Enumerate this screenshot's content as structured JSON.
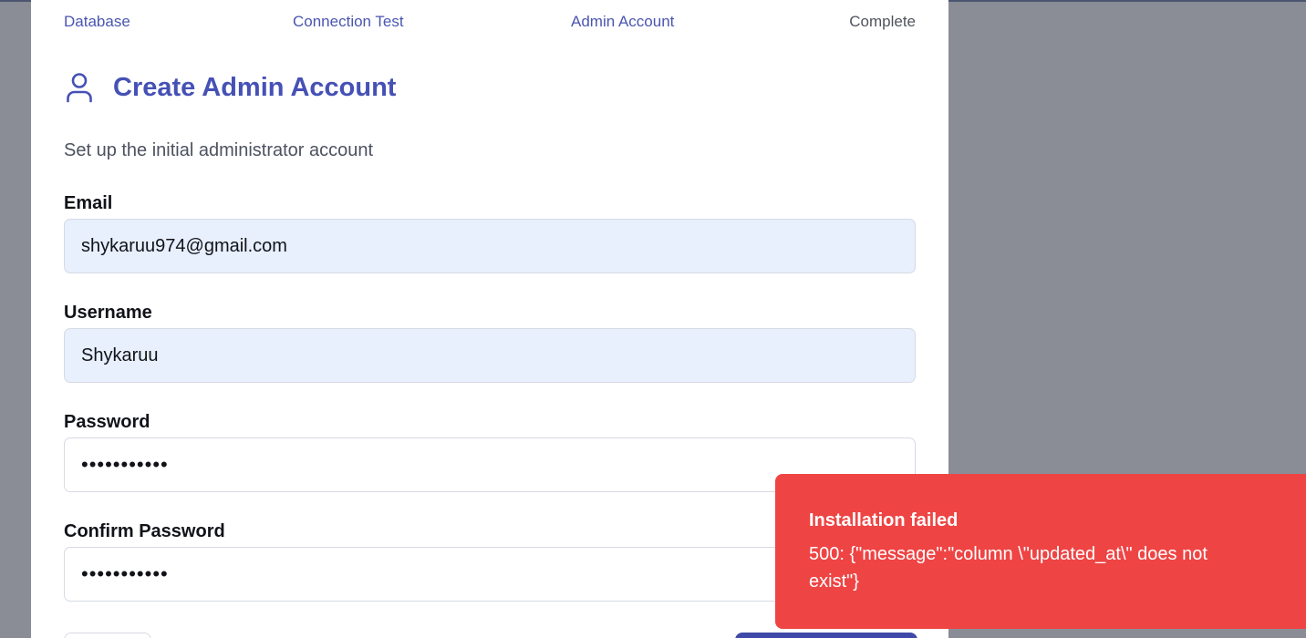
{
  "steps": [
    {
      "label": "Database"
    },
    {
      "label": "Connection Test"
    },
    {
      "label": "Admin Account"
    },
    {
      "label": "Complete"
    }
  ],
  "header": {
    "icon": "user-icon",
    "title": "Create Admin Account",
    "subtitle": "Set up the initial administrator account"
  },
  "form": {
    "email": {
      "label": "Email",
      "value": "shykaruu974@gmail.com"
    },
    "username": {
      "label": "Username",
      "value": "Shykaruu"
    },
    "password": {
      "label": "Password",
      "value": "•••••••••••"
    },
    "confirm_password": {
      "label": "Confirm Password",
      "value": "•••••••••••"
    }
  },
  "toast": {
    "title": "Installation failed",
    "message": "500: {\"message\":\"column \\\"updated_at\\\" does not exist\"}"
  },
  "colors": {
    "accent": "#4551b5",
    "error": "#ef4444",
    "backdrop": "#8a8c96",
    "autofill": "#e8effd"
  }
}
